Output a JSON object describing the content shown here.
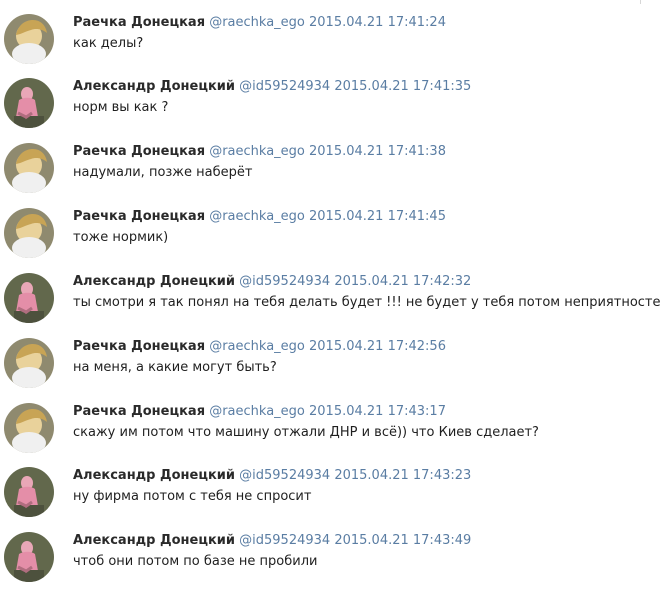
{
  "messages": [
    {
      "author": "Раечка Донецкая",
      "handle": "@raechka_ego",
      "timestamp": "2015.04.21 17:41:24",
      "text": "как делы?",
      "avatar": "raechka-avatar"
    },
    {
      "author": "Александр Донецкий",
      "handle": "@id59524934",
      "timestamp": "2015.04.21 17:41:35",
      "text": "норм вы как ?",
      "avatar": "alexander-avatar"
    },
    {
      "author": "Раечка Донецкая",
      "handle": "@raechka_ego",
      "timestamp": "2015.04.21 17:41:38",
      "text": "надумали, позже наберёт",
      "avatar": "raechka-avatar"
    },
    {
      "author": "Раечка Донецкая",
      "handle": "@raechka_ego",
      "timestamp": "2015.04.21 17:41:45",
      "text": "тоже нормик)",
      "avatar": "raechka-avatar"
    },
    {
      "author": "Александр Донецкий",
      "handle": "@id59524934",
      "timestamp": "2015.04.21 17:42:32",
      "text": "ты смотри я так понял на тебя делать будет !!! не будет у тебя потом неприятностей",
      "avatar": "alexander-avatar"
    },
    {
      "author": "Раечка Донецкая",
      "handle": "@raechka_ego",
      "timestamp": "2015.04.21 17:42:56",
      "text": "на меня, а какие могут быть?",
      "avatar": "raechka-avatar"
    },
    {
      "author": "Раечка Донецкая",
      "handle": "@raechka_ego",
      "timestamp": "2015.04.21 17:43:17",
      "text": "скажу им потом что машину отжали ДНР и всё)) что Киев сделает?",
      "avatar": "raechka-avatar"
    },
    {
      "author": "Александр Донецкий",
      "handle": "@id59524934",
      "timestamp": "2015.04.21 17:43:23",
      "text": "ну фирма потом с тебя не спросит",
      "avatar": "alexander-avatar"
    },
    {
      "author": "Александр Донецкий",
      "handle": "@id59524934",
      "timestamp": "2015.04.21 17:43:49",
      "text": "чтоб они потом по базе не пробили",
      "avatar": "alexander-avatar"
    }
  ]
}
